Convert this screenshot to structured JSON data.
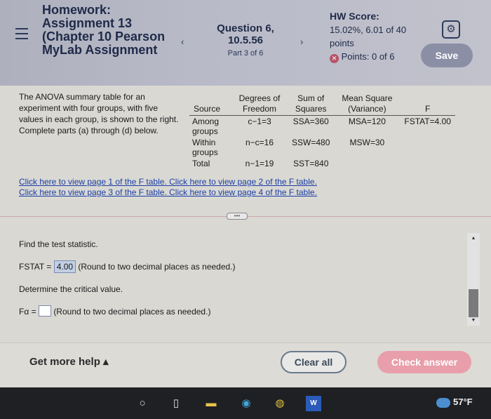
{
  "header": {
    "assignment_title": "Homework: Assignment 13 (Chapter 10 Pearson MyLab Assignment",
    "question_title": "Question 6, 10.5.56",
    "question_part": "Part 3 of 6",
    "hw_score_label": "HW Score:",
    "hw_score_value": "15.02%, 6.01 of 40 points",
    "points_label": "Points: 0 of 6",
    "save_label": "Save",
    "prev_arrow": "‹",
    "next_arrow": "›"
  },
  "problem": {
    "text": "The ANOVA summary table for an experiment with four groups, with five values in each group, is shown to the right. Complete parts (a) through (d) below.",
    "table": {
      "headers": [
        "Source",
        "Degrees of Freedom",
        "Sum of Squares",
        "Mean Square (Variance)",
        "F"
      ],
      "rows": [
        [
          "Among groups",
          "c−1=3",
          "SSA=360",
          "MSA=120",
          "FSTAT=4.00"
        ],
        [
          "Within groups",
          "n−c=16",
          "SSW=480",
          "MSW=30",
          ""
        ],
        [
          "Total",
          "n−1=19",
          "SST=840",
          "",
          ""
        ]
      ]
    },
    "links": [
      "Click here to view page 1 of the F table.",
      "Click here to view page 2 of the F table.",
      "Click here to view page 3 of the F table.",
      "Click here to view page 4 of the F table."
    ]
  },
  "expand_label": "•••",
  "part": {
    "find_stat": "Find the test statistic.",
    "fstat_label": "FSTAT",
    "fstat_value": "4.00",
    "round_note": "(Round to two decimal places as needed.)",
    "critical_prompt": "Determine the critical value.",
    "falpha_label": "Fα",
    "round_note_2": "(Round to two decimal places as needed.)"
  },
  "footer": {
    "help_label": "Get more help ▴",
    "clear_label": "Clear all",
    "check_label": "Check answer"
  },
  "taskbar": {
    "weather": "57°F"
  },
  "colors": {
    "header_bg": "#b8bac8",
    "save_button": "#8b8fa6",
    "check_button": "#e89fab",
    "link": "#1b3fa6"
  }
}
